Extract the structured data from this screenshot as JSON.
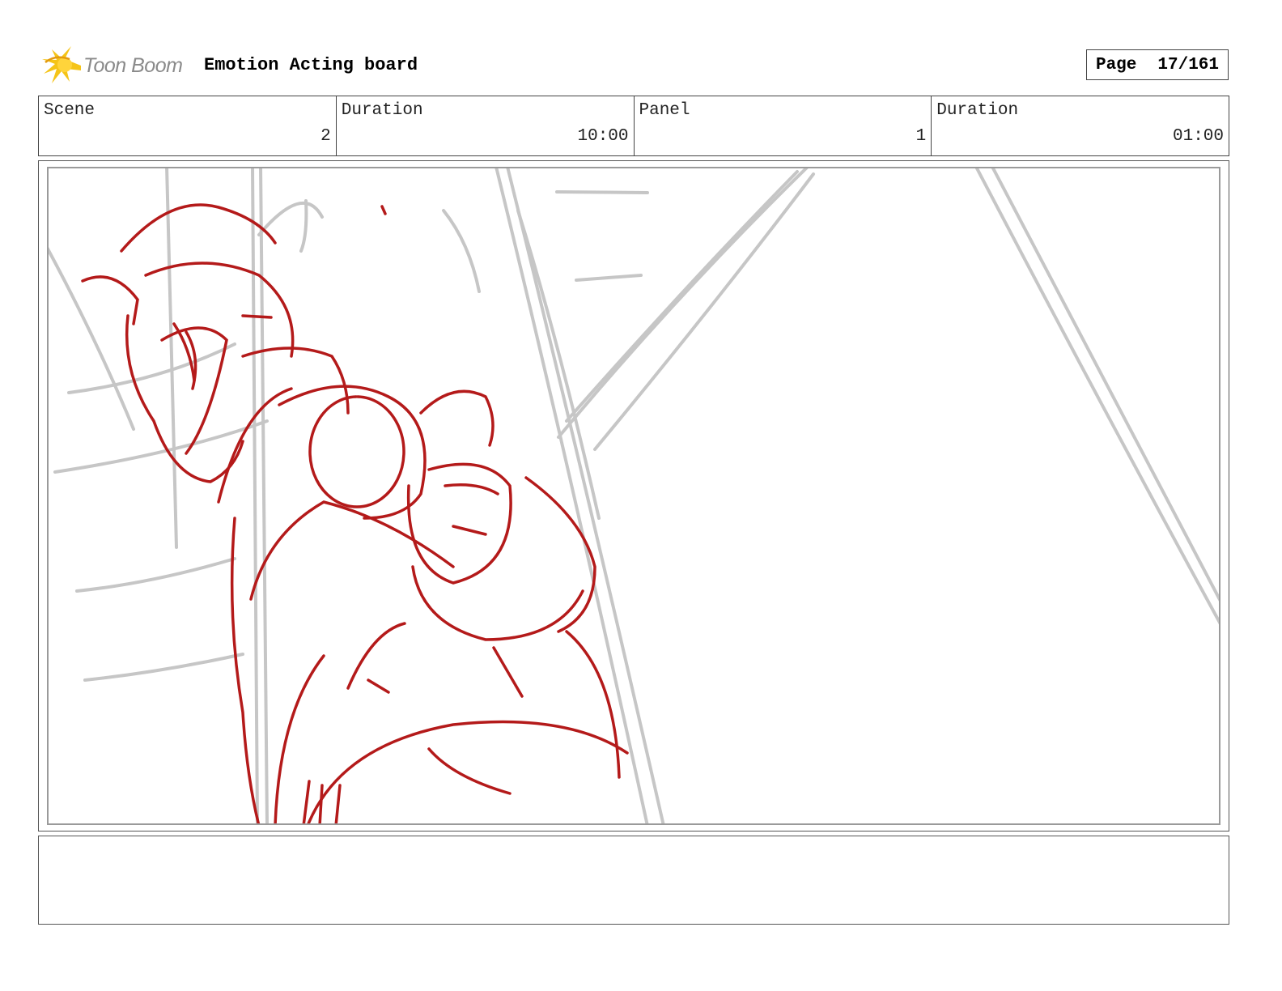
{
  "header": {
    "logo_text": "Toon Boom",
    "board_title": "Emotion Acting board",
    "page_label": "Page",
    "page_number": "17/161"
  },
  "info": [
    {
      "label": "Scene",
      "value": "2"
    },
    {
      "label": "Duration",
      "value": "10:00"
    },
    {
      "label": "Panel",
      "value": "1"
    },
    {
      "label": "Duration",
      "value": "01:00"
    }
  ],
  "colors": {
    "sketch_red": "#b41a1a",
    "sketch_gray": "#c6c6c6",
    "logo_yellow": "#f5c418"
  },
  "notes": ""
}
